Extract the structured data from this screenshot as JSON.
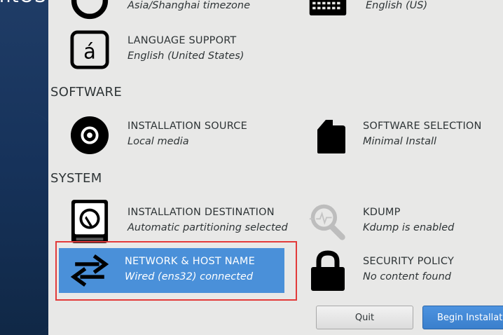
{
  "sidebar": {
    "brand_text": "ntOS"
  },
  "sections": {
    "software": "SOFTWARE",
    "system": "SYSTEM"
  },
  "spokes": {
    "timezone": {
      "title": "",
      "status": "Asia/Shanghai timezone",
      "icon": "clock-icon"
    },
    "keyboard": {
      "title": "",
      "status": "English (US)",
      "icon": "keyboard-icon"
    },
    "language": {
      "title": "LANGUAGE SUPPORT",
      "status": "English (United States)",
      "icon": "language-icon"
    },
    "source": {
      "title": "INSTALLATION SOURCE",
      "status": "Local media",
      "icon": "disc-icon"
    },
    "software_selection": {
      "title": "SOFTWARE SELECTION",
      "status": "Minimal Install",
      "icon": "package-icon"
    },
    "destination": {
      "title": "INSTALLATION DESTINATION",
      "status": "Automatic partitioning selected",
      "icon": "harddisk-icon"
    },
    "kdump": {
      "title": "KDUMP",
      "status": "Kdump is enabled",
      "icon": "search-icon"
    },
    "network": {
      "title": "NETWORK & HOST NAME",
      "status": "Wired (ens32) connected",
      "icon": "network-arrows-icon"
    },
    "security": {
      "title": "SECURITY POLICY",
      "status": "No content found",
      "icon": "lock-icon"
    }
  },
  "buttons": {
    "quit": "Quit",
    "begin": "Begin Installation"
  },
  "colors": {
    "background": "#e8e8e7",
    "sidebar": "#1f3c66",
    "selected": "#4a90d9",
    "highlight_frame": "#e23a3a",
    "primary_button": "#3a7fcc"
  }
}
